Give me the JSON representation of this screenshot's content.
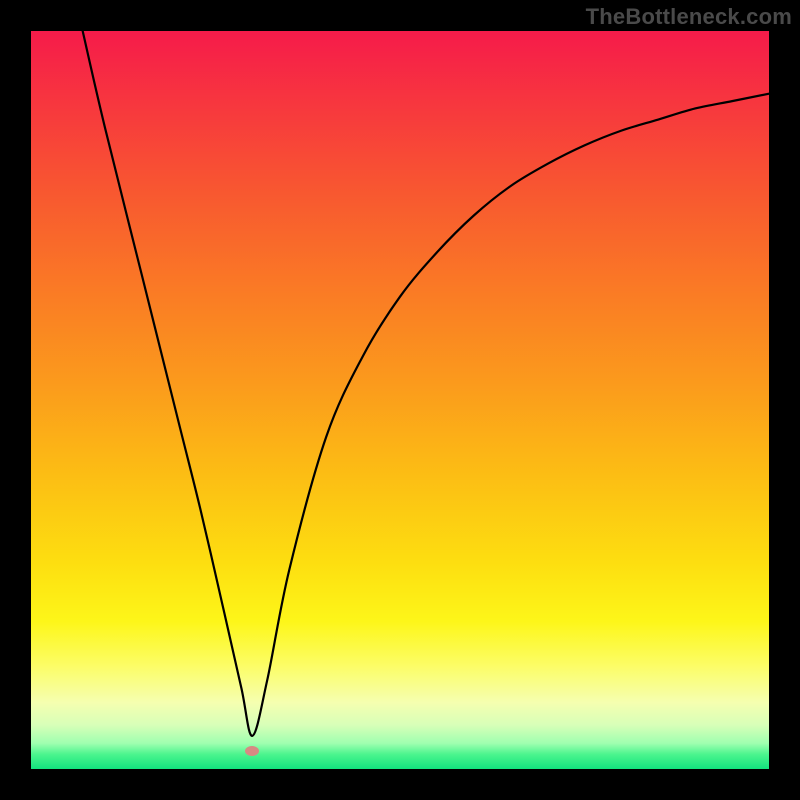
{
  "watermark": "TheBottleneck.com",
  "colors": {
    "frame": "#000000",
    "curve": "#000000",
    "dot": "#d68a83",
    "gradient_top": "#f61b4a",
    "gradient_bottom": "#12e37e"
  },
  "chart_data": {
    "type": "line",
    "title": "",
    "xlabel": "",
    "ylabel": "",
    "xlim": [
      0,
      100
    ],
    "ylim": [
      0,
      100
    ],
    "grid": false,
    "legend": false,
    "series": [
      {
        "name": "curve",
        "x": [
          7,
          10,
          15,
          20,
          23,
          26,
          28.5,
          30,
          32,
          35,
          40,
          45,
          50,
          55,
          60,
          65,
          70,
          75,
          80,
          85,
          90,
          95,
          100
        ],
        "y": [
          100,
          87,
          67,
          47,
          35,
          22,
          11,
          4.5,
          12,
          27,
          45,
          56,
          64,
          70,
          75,
          79,
          82,
          84.5,
          86.5,
          88,
          89.5,
          90.5,
          91.5
        ]
      }
    ],
    "annotations": [
      {
        "name": "min-point",
        "x": 30,
        "y": 2.5
      }
    ]
  }
}
